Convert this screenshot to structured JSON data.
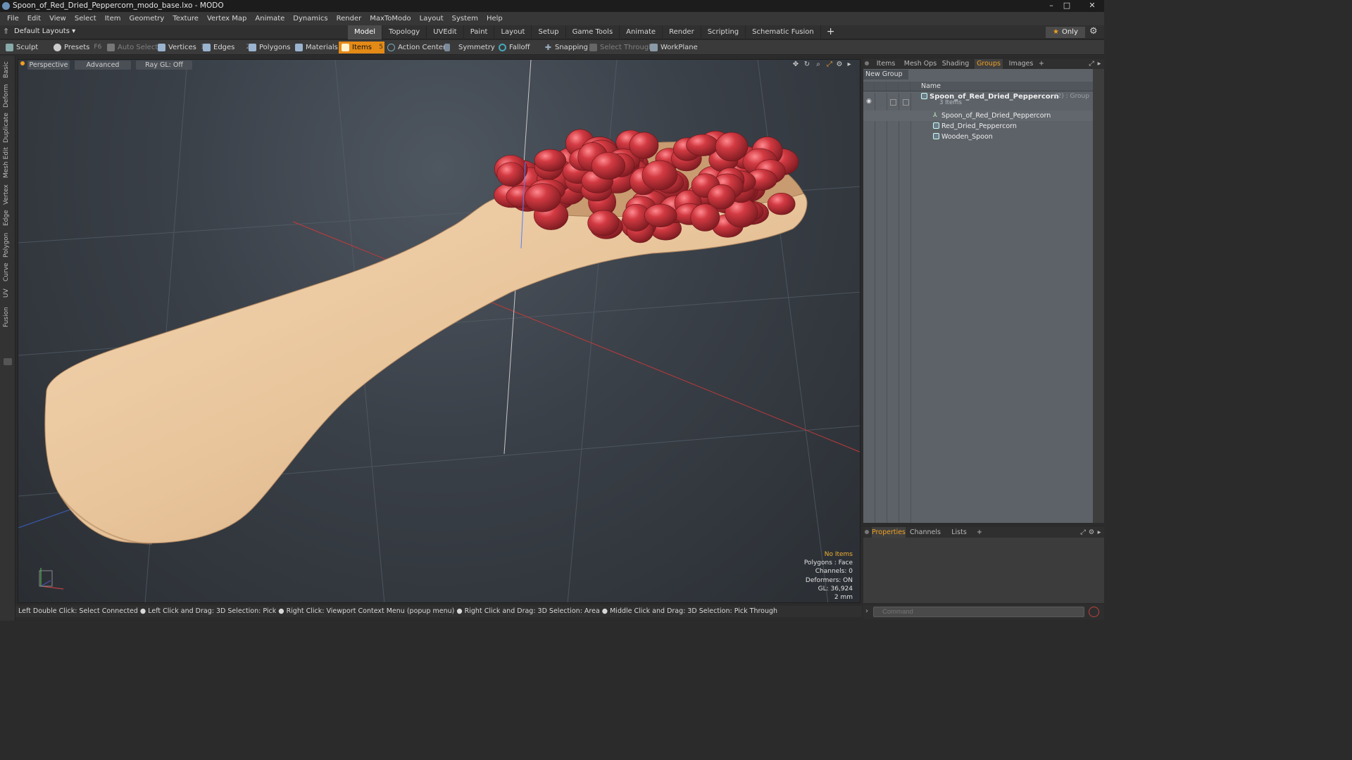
{
  "window": {
    "title": "Spoon_of_Red_Dried_Peppercorn_modo_base.lxo - MODO",
    "controls": [
      "–",
      "□",
      "✕"
    ]
  },
  "menu": [
    "File",
    "Edit",
    "View",
    "Select",
    "Item",
    "Geometry",
    "Texture",
    "Vertex Map",
    "Animate",
    "Dynamics",
    "Render",
    "MaxToModo",
    "Layout",
    "System",
    "Help"
  ],
  "layouts": {
    "label": "Default Layouts ▾"
  },
  "mode_tabs": [
    "Model",
    "Topology",
    "UVEdit",
    "Paint",
    "Layout",
    "Setup",
    "Game Tools",
    "Animate",
    "Render",
    "Scripting",
    "Schematic Fusion"
  ],
  "mode_tab_active": "Model",
  "only_button": "Only",
  "toolbar": {
    "sculpt": "Sculpt",
    "presets": "Presets",
    "presets_key": "F6",
    "auto_select": "Auto Select",
    "vertices": "Vertices",
    "vertices_key": "1",
    "edges": "Edges",
    "edges_key": "2",
    "polygons": "Polygons",
    "materials": "Materials",
    "items": "Items",
    "items_key": "5",
    "action_center": "Action Center",
    "symmetry": "Symmetry",
    "falloff": "Falloff",
    "snapping": "Snapping",
    "select_through": "Select Through",
    "workplane": "WorkPlane"
  },
  "left_tabs": [
    "Basic",
    "Deform",
    "Duplicate",
    "Mesh Edit",
    "Vertex",
    "Edge",
    "Polygon",
    "Curve",
    "UV",
    "Fusion"
  ],
  "viewport": {
    "view": "Perspective",
    "shading": "Advanced",
    "raygl": "Ray GL: Off",
    "info": {
      "no_items": "No Items",
      "polygons": "Polygons : Face",
      "channels": "Channels: 0",
      "deformers": "Deformers: ON",
      "gl": "GL: 36,924",
      "scale": "2 mm"
    }
  },
  "right_panel": {
    "tabs": [
      "Items",
      "Mesh Ops",
      "Shading",
      "Groups",
      "Images",
      "+"
    ],
    "active_tab": "Groups",
    "new_group": "New Group",
    "column_name": "Name",
    "group": {
      "name": "Spoon_of_Red_Dried_Peppercorn",
      "count": "(2) : Group",
      "sub": "3 Items",
      "children": [
        "Spoon_of_Red_Dried_Peppercorn",
        "Red_Dried_Peppercorn",
        "Wooden_Spoon"
      ]
    },
    "lower_tabs": [
      "Properties",
      "Channels",
      "Lists",
      "+"
    ],
    "lower_active": "Properties"
  },
  "statusbar": "Left Double Click: Select Connected ● Left Click and Drag: 3D Selection: Pick ● Right Click: Viewport Context Menu (popup menu) ● Right Click and Drag: 3D Selection: Area ● Middle Click and Drag: 3D Selection: Pick Through",
  "command": {
    "placeholder": "Command"
  },
  "colors": {
    "accent": "#e48a16",
    "wood": "#e6c29a",
    "peppercorn": "#b02a32"
  }
}
